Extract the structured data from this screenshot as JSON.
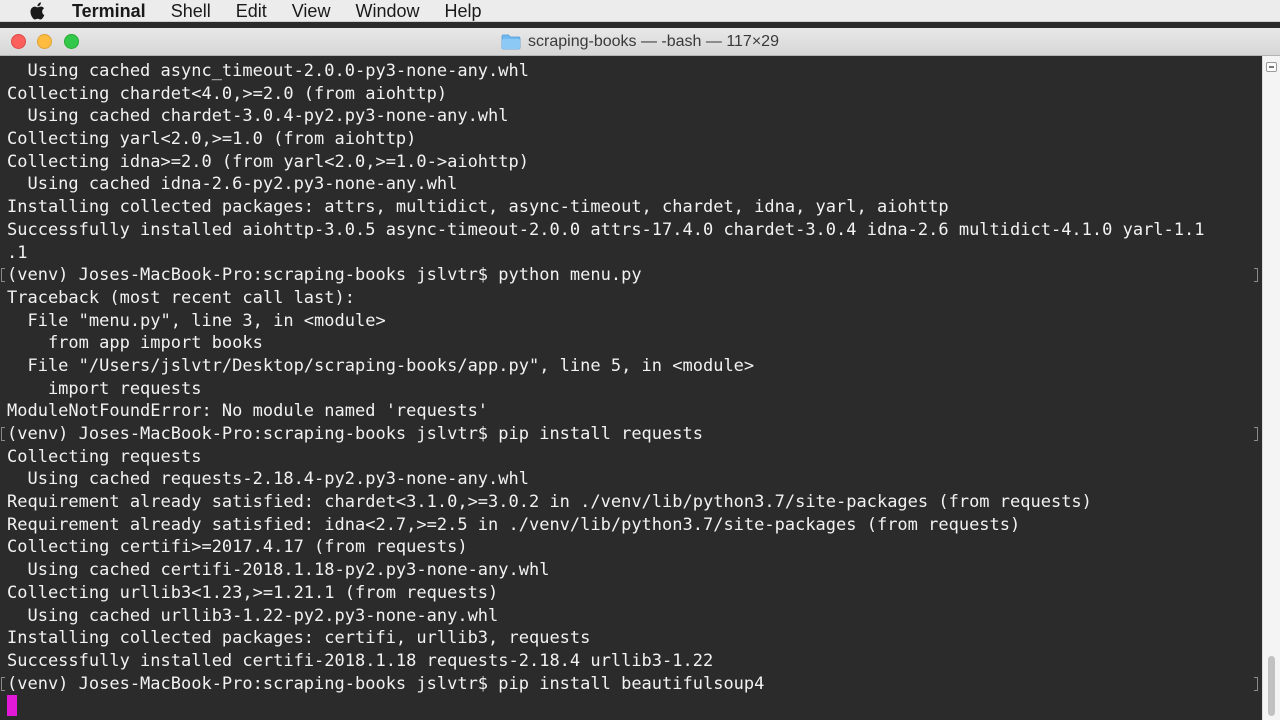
{
  "menubar": {
    "app_name": "Terminal",
    "items": [
      "Shell",
      "Edit",
      "View",
      "Window",
      "Help"
    ]
  },
  "window": {
    "title": "scraping-books — -bash — 117×29"
  },
  "terminal": {
    "lines": [
      "  Using cached async_timeout-2.0.0-py3-none-any.whl",
      "Collecting chardet<4.0,>=2.0 (from aiohttp)",
      "  Using cached chardet-3.0.4-py2.py3-none-any.whl",
      "Collecting yarl<2.0,>=1.0 (from aiohttp)",
      "Collecting idna>=2.0 (from yarl<2.0,>=1.0->aiohttp)",
      "  Using cached idna-2.6-py2.py3-none-any.whl",
      "Installing collected packages: attrs, multidict, async-timeout, chardet, idna, yarl, aiohttp",
      "Successfully installed aiohttp-3.0.5 async-timeout-2.0.0 attrs-17.4.0 chardet-3.0.4 idna-2.6 multidict-4.1.0 yarl-1.1",
      ".1",
      "(venv) Joses-MacBook-Pro:scraping-books jslvtr$ python menu.py",
      "Traceback (most recent call last):",
      "  File \"menu.py\", line 3, in <module>",
      "    from app import books",
      "  File \"/Users/jslvtr/Desktop/scraping-books/app.py\", line 5, in <module>",
      "    import requests",
      "ModuleNotFoundError: No module named 'requests'",
      "(venv) Joses-MacBook-Pro:scraping-books jslvtr$ pip install requests",
      "Collecting requests",
      "  Using cached requests-2.18.4-py2.py3-none-any.whl",
      "Requirement already satisfied: chardet<3.1.0,>=3.0.2 in ./venv/lib/python3.7/site-packages (from requests)",
      "Requirement already satisfied: idna<2.7,>=2.5 in ./venv/lib/python3.7/site-packages (from requests)",
      "Collecting certifi>=2017.4.17 (from requests)",
      "  Using cached certifi-2018.1.18-py2.py3-none-any.whl",
      "Collecting urllib3<1.23,>=1.21.1 (from requests)",
      "  Using cached urllib3-1.22-py2.py3-none-any.whl",
      "Installing collected packages: certifi, urllib3, requests",
      "Successfully installed certifi-2018.1.18 requests-2.18.4 urllib3-1.22",
      "(venv) Joses-MacBook-Pro:scraping-books jslvtr$ pip install beautifulsoup4",
      ""
    ],
    "prompt_line_indices": [
      9,
      16,
      27
    ]
  },
  "colors": {
    "background": "#2b2b2b",
    "text": "#f2f2f2",
    "cursor": "#e21ad8"
  },
  "icons": [
    "apple-icon",
    "folder-icon"
  ]
}
